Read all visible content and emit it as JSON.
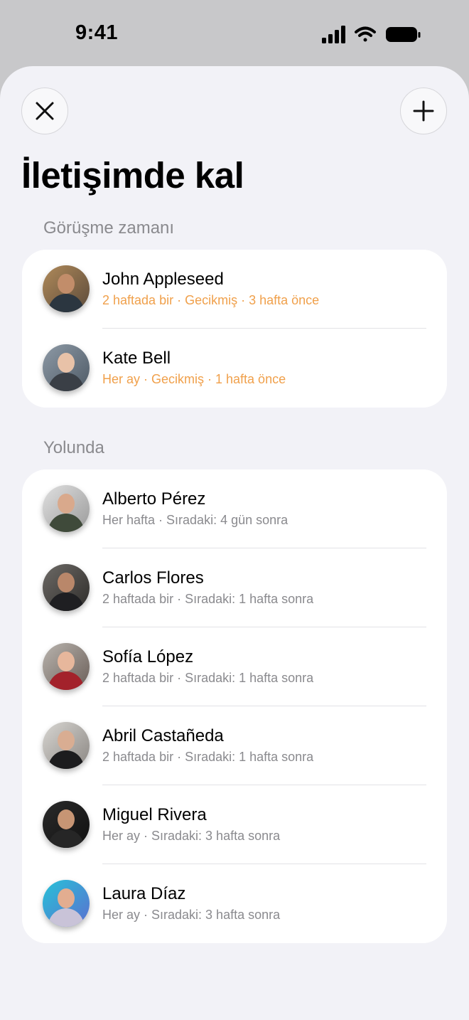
{
  "status_bar": {
    "time": "9:41"
  },
  "header": {
    "title": "İletişimde kal"
  },
  "sections": [
    {
      "title": "Görüşme zamanı",
      "contacts": [
        {
          "name": "John Appleseed",
          "subtitle": "2 haftada bir · Gecikmiş · 3 hafta önce",
          "status": "overdue"
        },
        {
          "name": "Kate Bell",
          "subtitle": "Her ay · Gecikmiş · 1 hafta önce",
          "status": "overdue"
        }
      ]
    },
    {
      "title": "Yolunda",
      "contacts": [
        {
          "name": "Alberto Pérez",
          "subtitle": "Her hafta · Sıradaki: 4 gün sonra",
          "status": "on-track"
        },
        {
          "name": "Carlos Flores",
          "subtitle": "2 haftada bir · Sıradaki: 1 hafta sonra",
          "status": "on-track"
        },
        {
          "name": "Sofía López",
          "subtitle": "2 haftada bir · Sıradaki: 1 hafta sonra",
          "status": "on-track"
        },
        {
          "name": "Abril Castañeda",
          "subtitle": "2 haftada bir · Sıradaki: 1 hafta sonra",
          "status": "on-track"
        },
        {
          "name": "Miguel Rivera",
          "subtitle": "Her ay · Sıradaki: 3 hafta sonra",
          "status": "on-track"
        },
        {
          "name": "Laura Díaz",
          "subtitle": "Her ay · Sıradaki: 3 hafta sonra",
          "status": "on-track"
        }
      ]
    }
  ],
  "colors": {
    "overdue": "#f0a04b",
    "secondary_text": "#8a8a8e",
    "sheet_background": "#f2f2f7",
    "card_background": "#ffffff"
  },
  "icons": {
    "close": "close-icon",
    "add": "plus-icon",
    "signal": "cellular-signal-icon",
    "wifi": "wifi-icon",
    "battery": "battery-icon"
  }
}
